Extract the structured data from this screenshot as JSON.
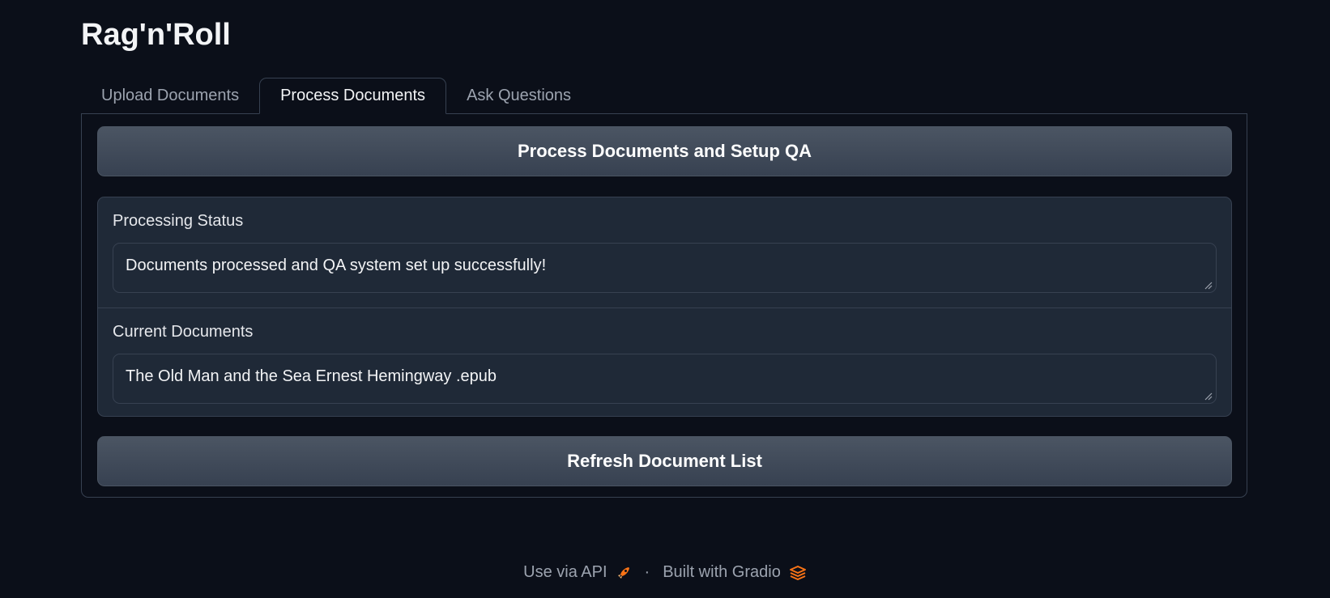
{
  "app": {
    "title": "Rag'n'Roll"
  },
  "tabs": [
    {
      "label": "Upload Documents",
      "active": false
    },
    {
      "label": "Process Documents",
      "active": true
    },
    {
      "label": "Ask Questions",
      "active": false
    }
  ],
  "process_panel": {
    "process_button_label": "Process Documents and Setup QA",
    "status": {
      "label": "Processing Status",
      "value": "Documents processed and QA system set up successfully!"
    },
    "documents": {
      "label": "Current Documents",
      "value": "The Old Man and the Sea Ernest Hemingway .epub"
    },
    "refresh_button_label": "Refresh Document List"
  },
  "footer": {
    "api_label": "Use via API",
    "api_icon": "rocket-icon",
    "separator": "·",
    "built_label": "Built with Gradio",
    "gradio_icon": "gradio-logo-icon",
    "accent_color": "#f97316"
  }
}
